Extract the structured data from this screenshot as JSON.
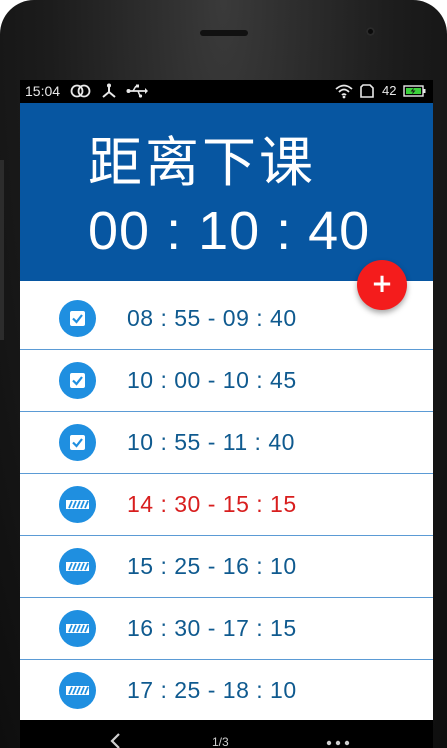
{
  "status_bar": {
    "time": "15:04",
    "battery_level": "42",
    "icons": [
      "dual-ring-icon",
      "network-share-icon",
      "usb-icon",
      "wifi-icon",
      "sim-icon",
      "battery-charging-icon"
    ]
  },
  "header": {
    "title": "距离下课",
    "countdown": "00 : 10 : 40",
    "background_color": "#0756a1"
  },
  "fab": {
    "label": "+",
    "icon": "plus-icon",
    "color": "#f41c1c"
  },
  "schedule": [
    {
      "time": "08 : 55 - 09 : 40",
      "status": "done",
      "icon": "checkbox-icon",
      "color": "#0f5a8f"
    },
    {
      "time": "10 : 00 - 10 : 45",
      "status": "done",
      "icon": "checkbox-icon",
      "color": "#0f5a8f"
    },
    {
      "time": "10 : 55 - 11 : 40",
      "status": "done",
      "icon": "checkbox-icon",
      "color": "#0f5a8f"
    },
    {
      "time": "14 : 30 - 15 : 15",
      "status": "current",
      "icon": "striped-bar-icon",
      "color": "#d81e1e"
    },
    {
      "time": "15 : 25 - 16 : 10",
      "status": "upcoming",
      "icon": "striped-bar-icon",
      "color": "#0f5a8f"
    },
    {
      "time": "16 : 30 - 17 : 15",
      "status": "upcoming",
      "icon": "striped-bar-icon",
      "color": "#0f5a8f"
    },
    {
      "time": "17 : 25 - 18 : 10",
      "status": "upcoming",
      "icon": "striped-bar-icon",
      "color": "#0f5a8f"
    }
  ],
  "nav_bar": {
    "page_indicator": "1/3",
    "back_icon": "chevron-left-icon",
    "more_icon": "more-dots-icon"
  }
}
